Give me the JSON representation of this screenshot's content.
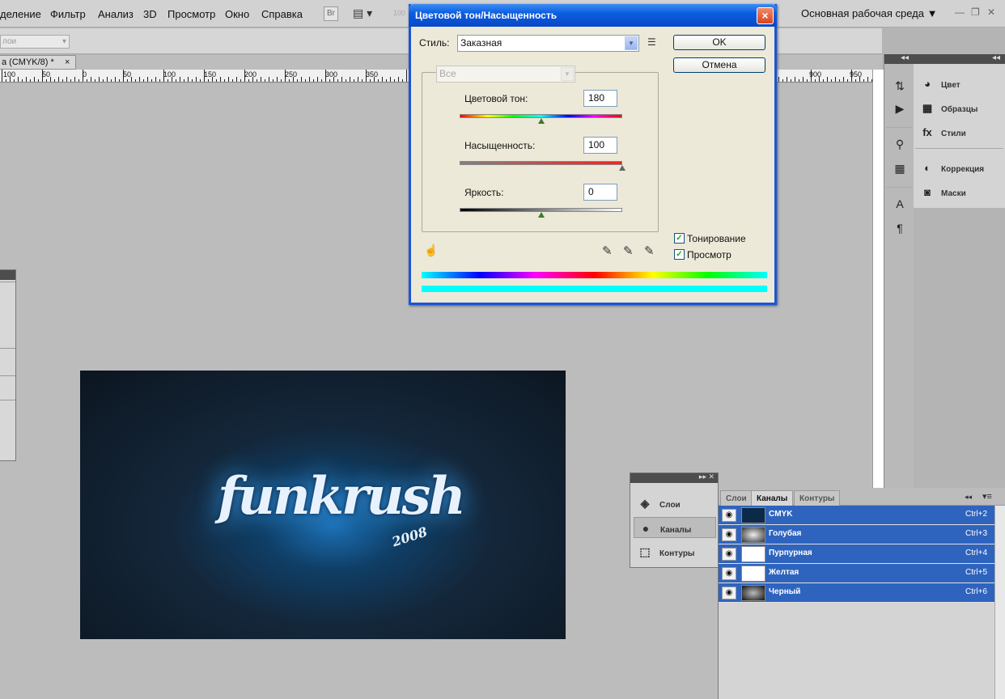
{
  "menubar": {
    "items": [
      "деление",
      "Фильтр",
      "Анализ",
      "3D",
      "Просмотр",
      "Окно",
      "Справка"
    ],
    "br_label": "Br",
    "workspace": "Основная рабочая среда ▼",
    "zoom_hint": "100"
  },
  "optbar": {
    "select_value": "лои"
  },
  "document": {
    "tab_title": "a (CMYK/8) *",
    "close": "×"
  },
  "ruler": {
    "labels": [
      "100",
      "50",
      "0",
      "50",
      "100",
      "150",
      "200",
      "250",
      "300",
      "350",
      "400",
      "900",
      "950"
    ]
  },
  "artwork": {
    "logo_text": "funkrush",
    "year": "2008"
  },
  "dialog": {
    "title": "Цветовой тон/Насыщенность",
    "close": "×",
    "style_label": "Стиль:",
    "style_value": "Заказная",
    "ok": "OK",
    "cancel": "Отмена",
    "range_value": "Все",
    "hue_label": "Цветовой тон:",
    "hue_value": "180",
    "sat_label": "Насыщенность:",
    "sat_value": "100",
    "light_label": "Яркость:",
    "light_value": "0",
    "colorize_label": "Тонирование",
    "preview_label": "Просмотр",
    "hue_pos": 0.5,
    "sat_pos": 1.0,
    "light_pos": 0.5
  },
  "dock": {
    "items": [
      "Цвет",
      "Образцы",
      "Стили",
      "Коррекция",
      "Маски"
    ]
  },
  "mini_panel": {
    "items": [
      "Слои",
      "Каналы",
      "Контуры"
    ]
  },
  "channels": {
    "tabs": [
      "Слои",
      "Каналы",
      "Контуры"
    ],
    "rows": [
      {
        "name": "CMYK",
        "key": "Ctrl+2"
      },
      {
        "name": "Голубая",
        "key": "Ctrl+3"
      },
      {
        "name": "Пурпурная",
        "key": "Ctrl+4"
      },
      {
        "name": "Желтая",
        "key": "Ctrl+5"
      },
      {
        "name": "Черный",
        "key": "Ctrl+6"
      }
    ]
  },
  "colors": {
    "dialog_border": "#1c55d6",
    "channel_selected": "#2f64be",
    "canvas": "#bcbcbc"
  }
}
